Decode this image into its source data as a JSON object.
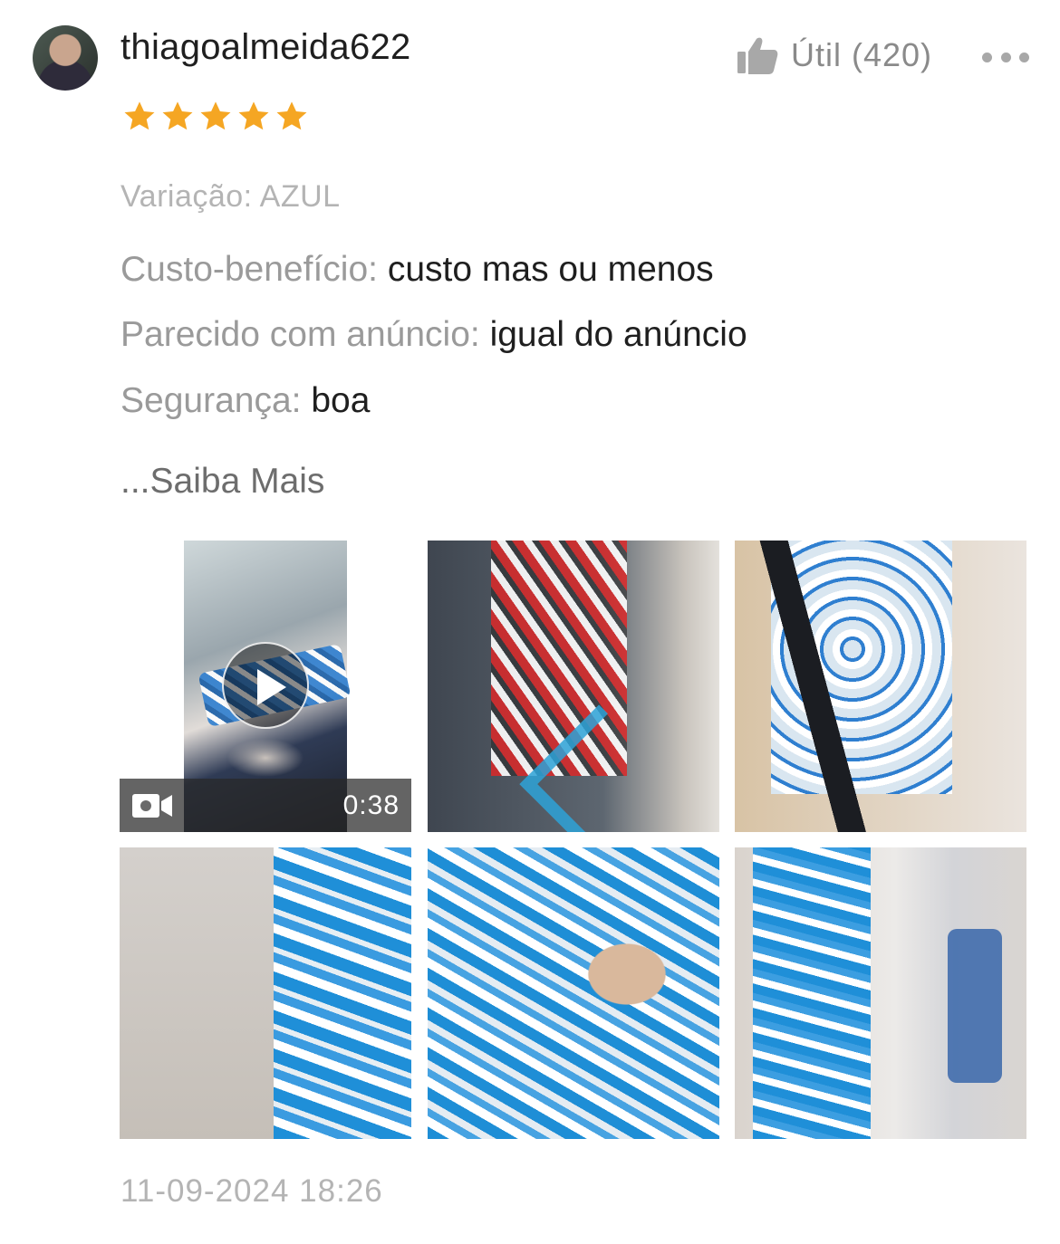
{
  "review": {
    "username": "thiagoalmeida622",
    "helpful_label": "Útil (420)",
    "rating": 5,
    "variation": "Variação: AZUL",
    "attributes": [
      {
        "key": "Custo-benefício:",
        "value": "custo mas ou menos"
      },
      {
        "key": "Parecido com anúncio:",
        "value": "igual do anúncio"
      },
      {
        "key": "Segurança:",
        "value": "boa"
      }
    ],
    "read_more": "...Saiba Mais",
    "video_duration": "0:38",
    "date": "11-09-2024 18:26"
  },
  "icons": {
    "helpful": "thumbs-up-icon",
    "more": "more-dots-icon",
    "star": "star-icon",
    "play": "play-icon",
    "video": "video-camera-icon"
  },
  "colors": {
    "star": "#F5A623",
    "text_primary": "#1F1F1F",
    "text_muted": "#9A9A9A"
  }
}
